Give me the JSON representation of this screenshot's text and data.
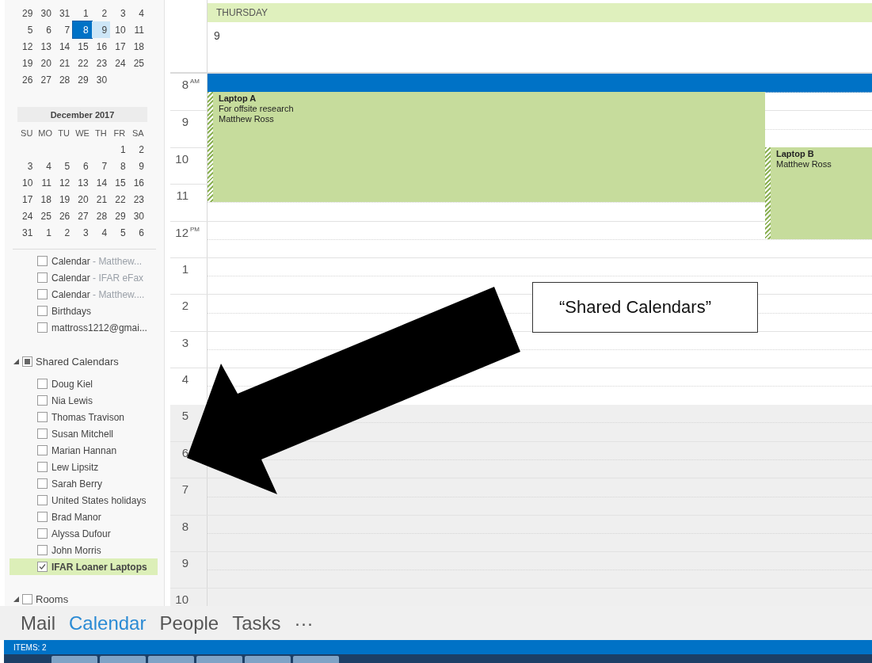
{
  "sidebar": {
    "mini_calendars": [
      {
        "weeks": [
          [
            {
              "d": "29",
              "kind": "day"
            },
            {
              "d": "30",
              "kind": "day"
            },
            {
              "d": "31",
              "kind": "day"
            },
            {
              "d": "1",
              "kind": "day"
            },
            {
              "d": "2",
              "kind": "day"
            },
            {
              "d": "3",
              "kind": "day"
            },
            {
              "d": "4",
              "kind": "day"
            }
          ],
          [
            {
              "d": "5",
              "kind": "day"
            },
            {
              "d": "6",
              "kind": "day"
            },
            {
              "d": "7",
              "kind": "day"
            },
            {
              "d": "8",
              "kind": "today"
            },
            {
              "d": "9",
              "kind": "selected"
            },
            {
              "d": "10",
              "kind": "day"
            },
            {
              "d": "11",
              "kind": "day"
            }
          ],
          [
            {
              "d": "12",
              "kind": "day"
            },
            {
              "d": "13",
              "kind": "day"
            },
            {
              "d": "14",
              "kind": "day"
            },
            {
              "d": "15",
              "kind": "day"
            },
            {
              "d": "16",
              "kind": "day"
            },
            {
              "d": "17",
              "kind": "day"
            },
            {
              "d": "18",
              "kind": "day"
            }
          ],
          [
            {
              "d": "19",
              "kind": "day"
            },
            {
              "d": "20",
              "kind": "day"
            },
            {
              "d": "21",
              "kind": "day"
            },
            {
              "d": "22",
              "kind": "day"
            },
            {
              "d": "23",
              "kind": "day"
            },
            {
              "d": "24",
              "kind": "day"
            },
            {
              "d": "25",
              "kind": "day"
            }
          ],
          [
            {
              "d": "26",
              "kind": "day"
            },
            {
              "d": "27",
              "kind": "day"
            },
            {
              "d": "28",
              "kind": "day"
            },
            {
              "d": "29",
              "kind": "day"
            },
            {
              "d": "30",
              "kind": "day"
            }
          ]
        ]
      },
      {
        "title": "December 2017",
        "weekdays": [
          "SU",
          "MO",
          "TU",
          "WE",
          "TH",
          "FR",
          "SA"
        ],
        "weeks": [
          [
            {
              "d": "1",
              "kind": "day"
            },
            {
              "d": "2",
              "kind": "day"
            }
          ],
          [
            {
              "d": "3",
              "kind": "day"
            },
            {
              "d": "4",
              "kind": "day"
            },
            {
              "d": "5",
              "kind": "day"
            },
            {
              "d": "6",
              "kind": "day"
            },
            {
              "d": "7",
              "kind": "day"
            },
            {
              "d": "8",
              "kind": "day"
            },
            {
              "d": "9",
              "kind": "day"
            }
          ],
          [
            {
              "d": "10",
              "kind": "day"
            },
            {
              "d": "11",
              "kind": "day"
            },
            {
              "d": "12",
              "kind": "day"
            },
            {
              "d": "13",
              "kind": "day"
            },
            {
              "d": "14",
              "kind": "day"
            },
            {
              "d": "15",
              "kind": "day"
            },
            {
              "d": "16",
              "kind": "day"
            }
          ],
          [
            {
              "d": "17",
              "kind": "day"
            },
            {
              "d": "18",
              "kind": "day"
            },
            {
              "d": "19",
              "kind": "day"
            },
            {
              "d": "20",
              "kind": "day"
            },
            {
              "d": "21",
              "kind": "day"
            },
            {
              "d": "22",
              "kind": "day"
            },
            {
              "d": "23",
              "kind": "day"
            }
          ],
          [
            {
              "d": "24",
              "kind": "day"
            },
            {
              "d": "25",
              "kind": "day"
            },
            {
              "d": "26",
              "kind": "day"
            },
            {
              "d": "27",
              "kind": "day"
            },
            {
              "d": "28",
              "kind": "day"
            },
            {
              "d": "29",
              "kind": "day"
            },
            {
              "d": "30",
              "kind": "day"
            }
          ],
          [
            {
              "d": "31",
              "kind": "day"
            },
            {
              "d": "1",
              "kind": "day"
            },
            {
              "d": "2",
              "kind": "day"
            },
            {
              "d": "3",
              "kind": "day"
            },
            {
              "d": "4",
              "kind": "day"
            },
            {
              "d": "5",
              "kind": "day"
            },
            {
              "d": "6",
              "kind": "day"
            }
          ]
        ]
      }
    ],
    "calendar_list": [
      {
        "label": "Calendar",
        "detail": "- Matthew...",
        "checked": false,
        "selected": false
      },
      {
        "label": "Calendar",
        "detail": "- IFAR eFax",
        "checked": false,
        "selected": false
      },
      {
        "label": "Calendar",
        "detail": "- Matthew....",
        "checked": false,
        "selected": false
      },
      {
        "label": "Birthdays",
        "checked": false,
        "selected": false
      },
      {
        "label": "mattross1212@gmai...",
        "checked": false,
        "selected": false
      }
    ],
    "groups": [
      {
        "label": "Shared Calendars",
        "expanded": true,
        "indeterminate": true,
        "items": [
          {
            "label": "Doug Kiel",
            "checked": false,
            "selected": false
          },
          {
            "label": "Nia Lewis",
            "checked": false,
            "selected": false
          },
          {
            "label": "Thomas Travison",
            "checked": false,
            "selected": false
          },
          {
            "label": "Susan Mitchell",
            "checked": false,
            "selected": false
          },
          {
            "label": "Marian Hannan",
            "checked": false,
            "selected": false
          },
          {
            "label": "Lew Lipsitz",
            "checked": false,
            "selected": false
          },
          {
            "label": "Sarah Berry",
            "checked": false,
            "selected": false
          },
          {
            "label": "United States holidays",
            "checked": false,
            "selected": false
          },
          {
            "label": "Brad Manor",
            "checked": false,
            "selected": false
          },
          {
            "label": "Alyssa Dufour",
            "checked": false,
            "selected": false
          },
          {
            "label": "John Morris",
            "checked": false,
            "selected": false
          },
          {
            "label": "IFAR Loaner Laptops",
            "checked": true,
            "selected": true
          }
        ]
      },
      {
        "label": "Rooms",
        "expanded": true,
        "indeterminate": false
      }
    ]
  },
  "day_view": {
    "day_name": "THURSDAY",
    "date": "9",
    "first_half_hour_selected": true,
    "hours": [
      {
        "label": "8",
        "suffix": "AM"
      },
      {
        "label": "9"
      },
      {
        "label": "10"
      },
      {
        "label": "11"
      },
      {
        "label": "12",
        "suffix": "PM"
      },
      {
        "label": "1"
      },
      {
        "label": "2"
      },
      {
        "label": "3"
      },
      {
        "label": "4"
      },
      {
        "label": "5",
        "off_hours": true
      },
      {
        "label": "6",
        "off_hours": true
      },
      {
        "label": "7",
        "off_hours": true
      },
      {
        "label": "8",
        "off_hours": true
      },
      {
        "label": "9",
        "off_hours": true
      },
      {
        "label": "10",
        "off_hours": true
      }
    ],
    "events": [
      {
        "title": "Laptop A",
        "lines": [
          "For offsite research",
          "Matthew Ross"
        ]
      },
      {
        "title": "Laptop B",
        "lines": [
          "Matthew Ross"
        ]
      }
    ]
  },
  "nav": [
    {
      "label": "Mail",
      "selected": false
    },
    {
      "label": "Calendar",
      "selected": true
    },
    {
      "label": "People",
      "selected": false
    },
    {
      "label": "Tasks",
      "selected": false
    },
    {
      "label": "···",
      "selected": false
    }
  ],
  "status_bar": {
    "items": "ITEMS: 2"
  },
  "annotation": {
    "label": "“Shared Calendars”"
  }
}
